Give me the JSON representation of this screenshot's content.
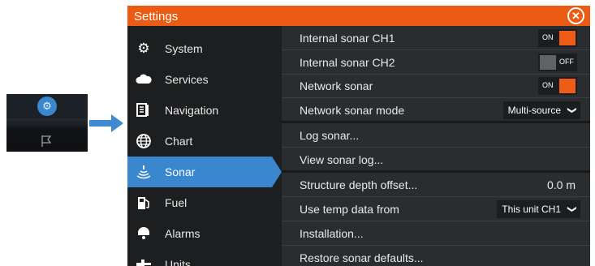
{
  "window": {
    "title": "Settings"
  },
  "sidebar": {
    "items": [
      {
        "label": "System",
        "icon": "gear-icon"
      },
      {
        "label": "Services",
        "icon": "cloud-icon"
      },
      {
        "label": "Navigation",
        "icon": "navigation-icon"
      },
      {
        "label": "Chart",
        "icon": "globe-icon"
      },
      {
        "label": "Sonar",
        "icon": "sonar-icon",
        "selected": true
      },
      {
        "label": "Fuel",
        "icon": "fuel-pump-icon"
      },
      {
        "label": "Alarms",
        "icon": "alarm-icon"
      },
      {
        "label": "Units",
        "icon": "units-icon"
      }
    ]
  },
  "panel": {
    "internal_ch1": {
      "label": "Internal sonar CH1",
      "toggle": "ON"
    },
    "internal_ch2": {
      "label": "Internal sonar CH2",
      "toggle": "OFF"
    },
    "network_sonar": {
      "label": "Network sonar",
      "toggle": "ON"
    },
    "network_mode": {
      "label": "Network sonar mode",
      "value": "Multi-source"
    },
    "log_sonar": {
      "label": "Log sonar..."
    },
    "view_log": {
      "label": "View sonar log..."
    },
    "structure_offset": {
      "label": "Structure depth offset...",
      "value": "0.0 m"
    },
    "temp_data": {
      "label": "Use temp data from",
      "value": "This unit CH1"
    },
    "installation": {
      "label": "Installation..."
    },
    "restore": {
      "label": "Restore sonar defaults..."
    }
  },
  "colors": {
    "accent": "#eb5b13",
    "selected": "#3a86cf",
    "panel": "#2a2d30",
    "sidebar": "#1c1e20"
  }
}
